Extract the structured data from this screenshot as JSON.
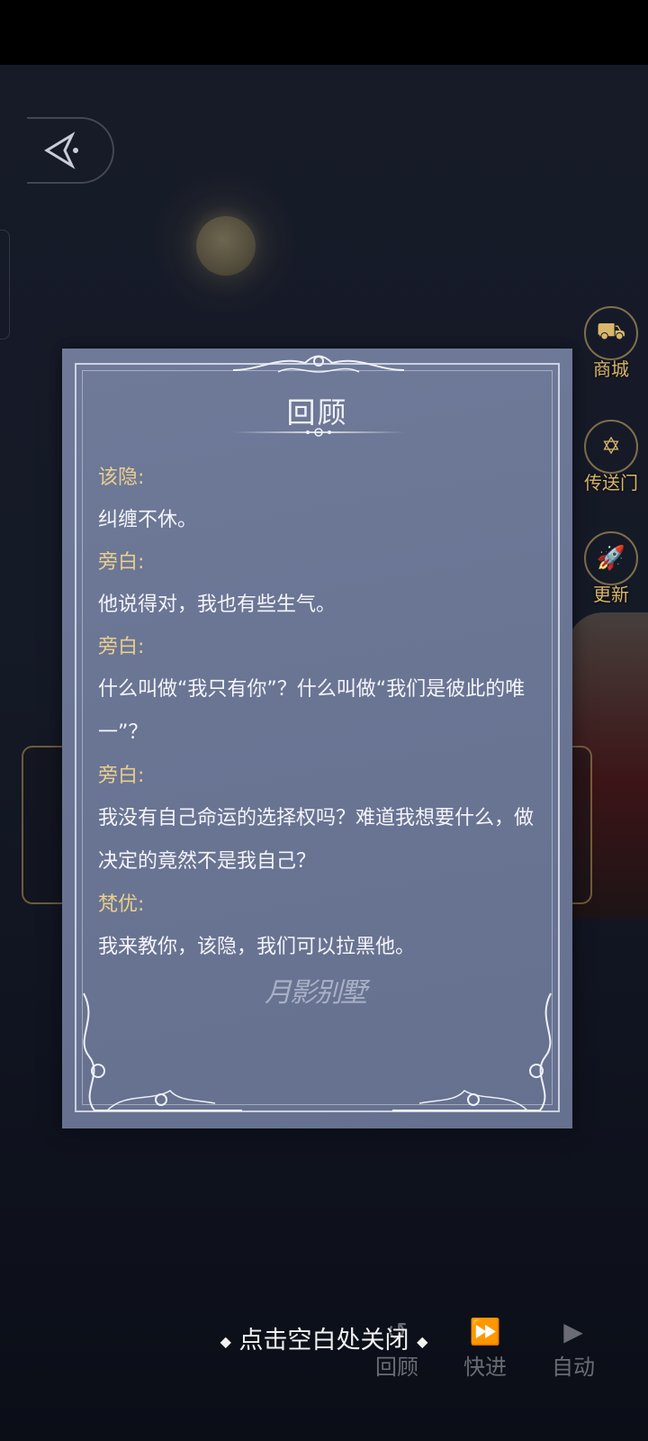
{
  "side_menu": [
    {
      "label": "商城",
      "icon": "cart-icon"
    },
    {
      "label": "传送门",
      "icon": "portal-icon"
    },
    {
      "label": "更新",
      "icon": "rocket-icon"
    }
  ],
  "background": {
    "speaker_name": "梵优",
    "dialog_text": "我来教你，该隐，我们可以拉黑他。"
  },
  "bottom_controls": [
    {
      "label": "回顾",
      "icon": "review-icon"
    },
    {
      "label": "快进",
      "icon": "fast-forward-icon"
    },
    {
      "label": "自动",
      "icon": "play-icon"
    }
  ],
  "review_panel": {
    "title": "回顾",
    "watermark": "月影别墅",
    "entries": [
      {
        "speaker": "该隐:",
        "text": "纠缠不休。"
      },
      {
        "speaker": "旁白:",
        "text": "他说得对，我也有些生气。"
      },
      {
        "speaker": "旁白:",
        "text": "什么叫做“我只有你”？什么叫做“我们是彼此的唯一”？"
      },
      {
        "speaker": "旁白:",
        "text": "我没有自己命运的选择权吗？难道我想要什么，做决定的竟然不是我自己？"
      },
      {
        "speaker": "梵优:",
        "text": "我来教你，该隐，我们可以拉黑他。"
      }
    ]
  },
  "close_hint": "点击空白处关闭",
  "colors": {
    "panel_bg": "#6f7a99",
    "speaker": "#e9cf8d",
    "menu_gold": "#d9b76a"
  }
}
